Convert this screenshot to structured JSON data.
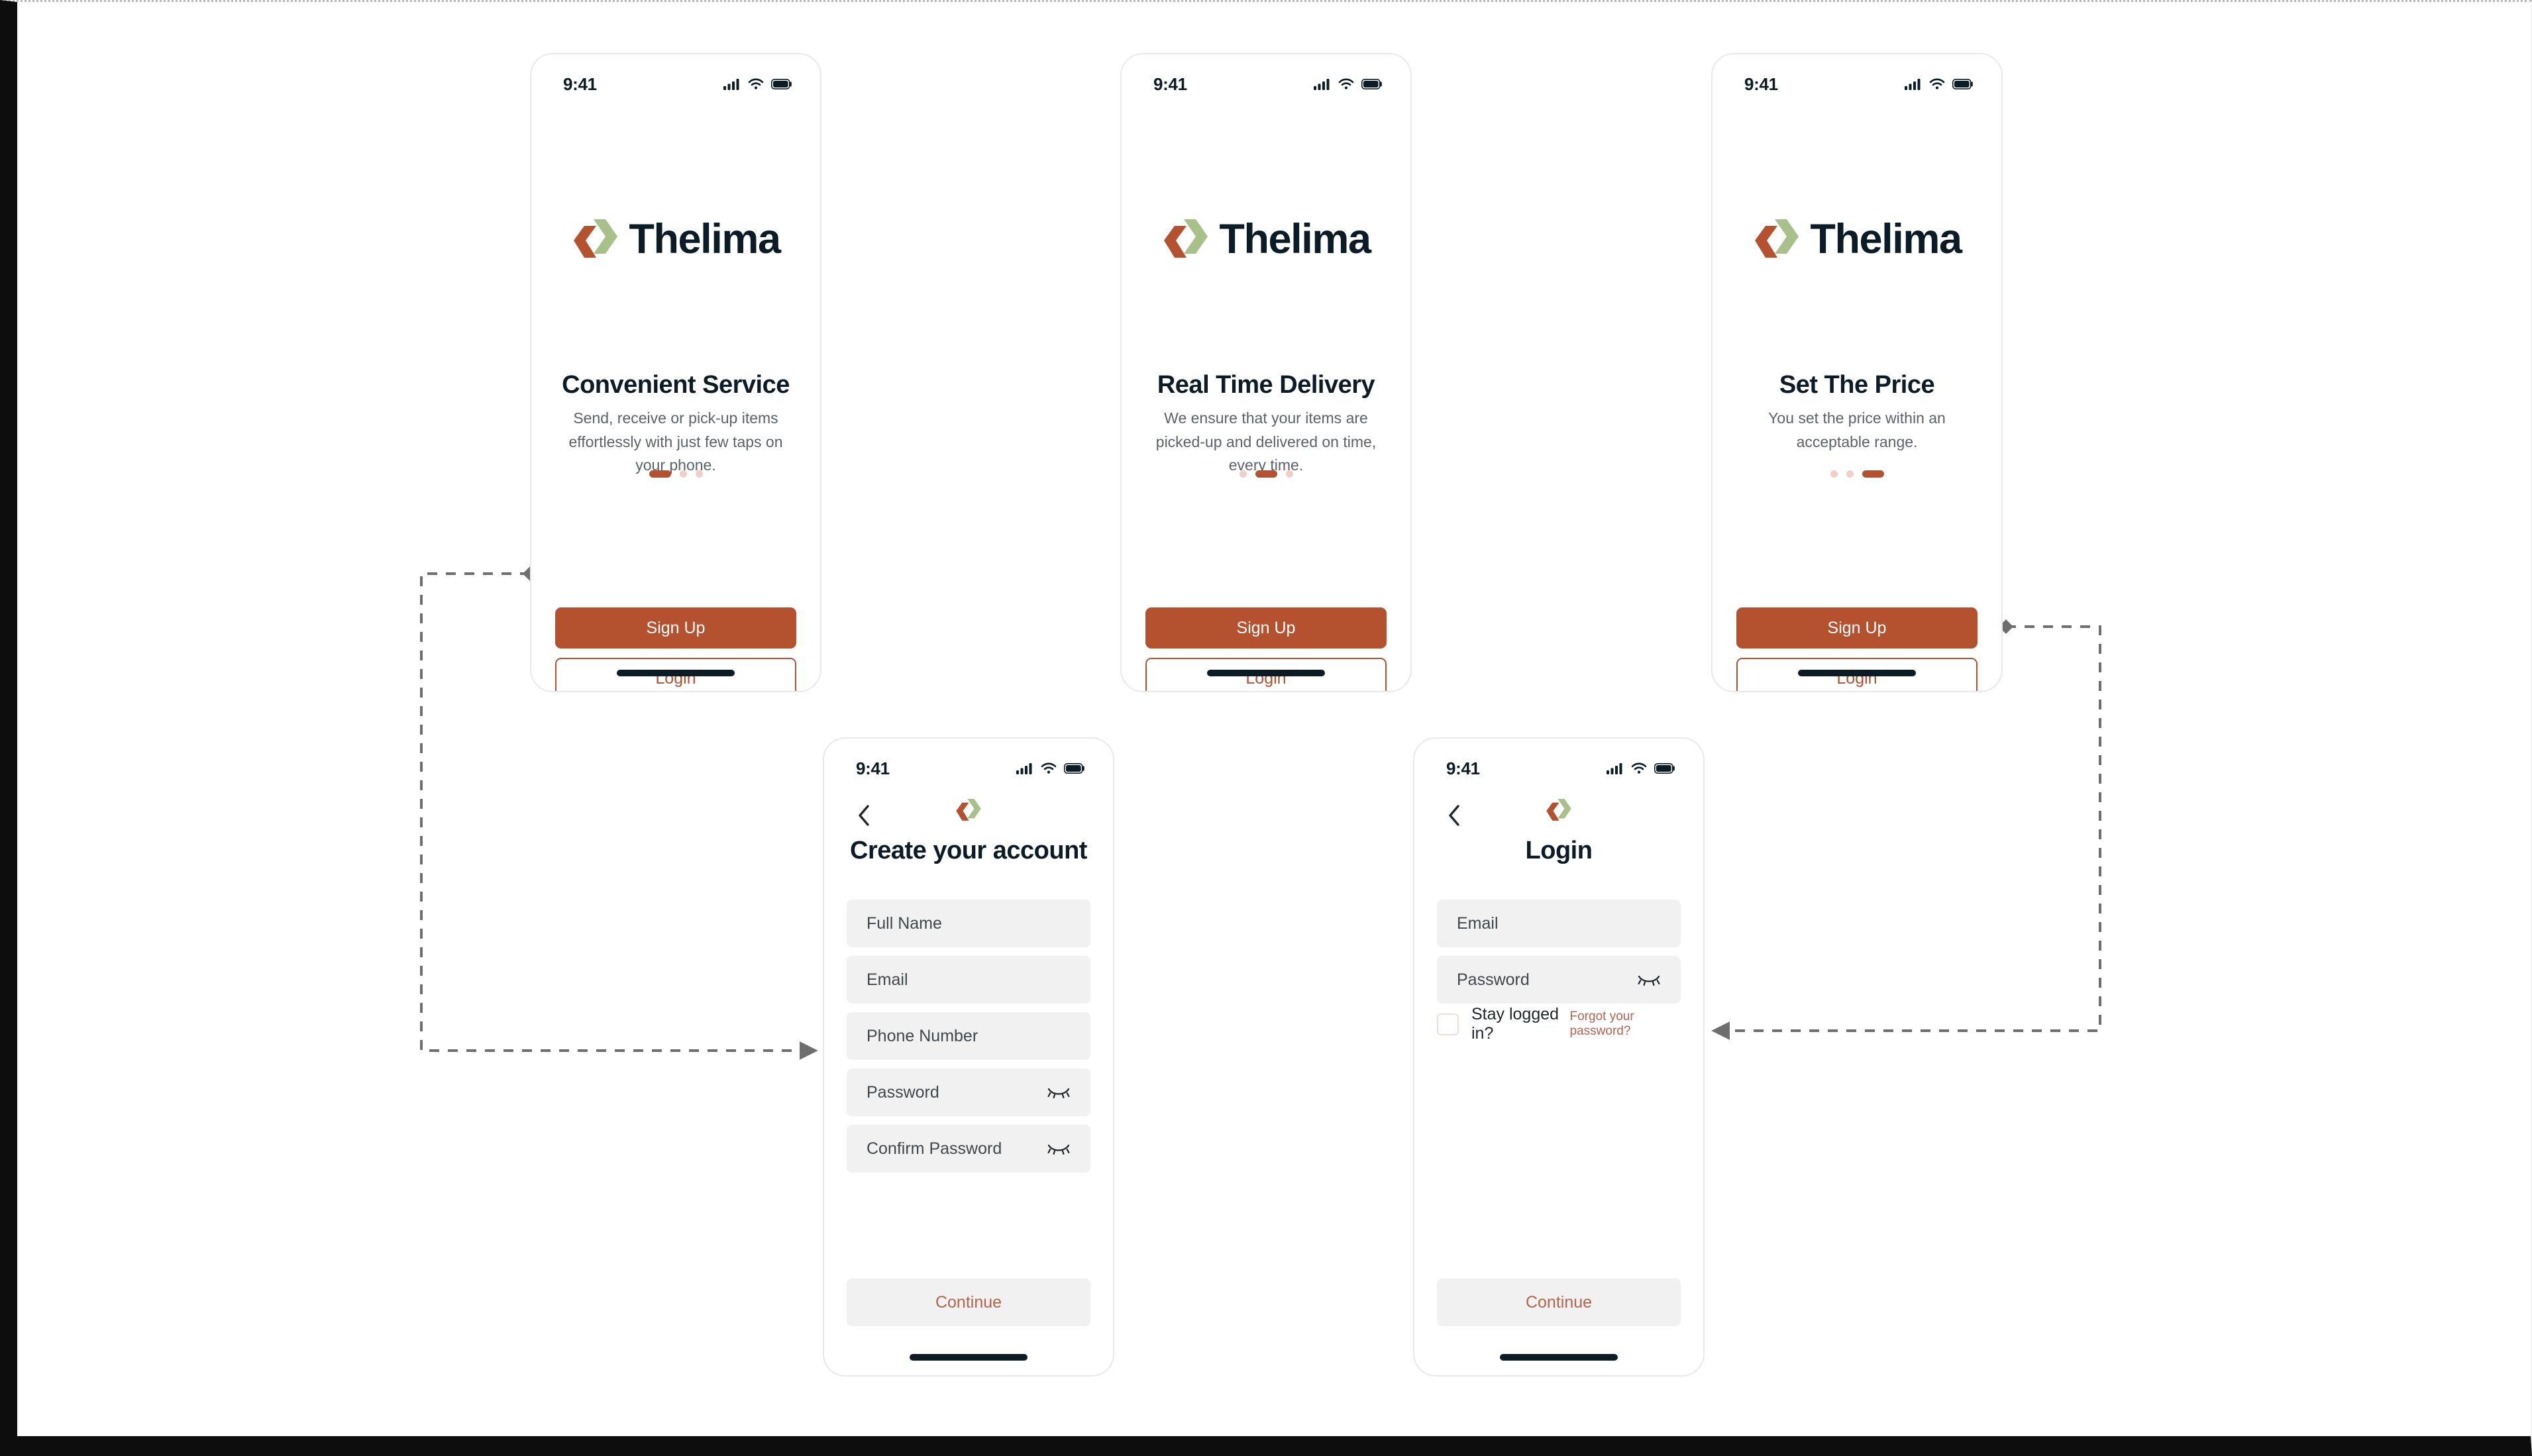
{
  "artboard": {
    "background": "#ffffff",
    "frame_color": "#0d0d0d"
  },
  "brand": {
    "name": "Thelima",
    "primary_color": "#b4512f",
    "accent_green": "#a8c089",
    "dark": "#0b1c27",
    "muted_text": "#5d6266",
    "field_bg": "#f1f1f1",
    "link_color": "#b4644d"
  },
  "status_bar": {
    "time": "9:41",
    "icons": [
      "cellular-signal-icon",
      "wifi-icon",
      "battery-icon"
    ]
  },
  "onboarding": [
    {
      "id": "convenient-service",
      "title": "Convenient Service",
      "subtitle": "Send, receive or pick-up items effortlessly with just few taps on your phone.",
      "active_dot": 0,
      "dot_count": 3,
      "primary_button": "Sign Up",
      "secondary_button": "Login"
    },
    {
      "id": "real-time-delivery",
      "title": "Real Time Delivery",
      "subtitle": "We ensure that your items are picked-up and delivered on time, every time.",
      "active_dot": 1,
      "dot_count": 3,
      "primary_button": "Sign Up",
      "secondary_button": "Login"
    },
    {
      "id": "set-the-price",
      "title": "Set The Price",
      "subtitle": "You set the price within an acceptable range.",
      "active_dot": 2,
      "dot_count": 3,
      "primary_button": "Sign Up",
      "secondary_button": "Login"
    }
  ],
  "signup_screen": {
    "title": "Create your account",
    "back_icon": "chevron-left-icon",
    "fields": [
      {
        "label": "Full Name",
        "placeholder": "Full Name",
        "type": "text",
        "toggle_icon": null
      },
      {
        "label": "Email",
        "placeholder": "Email",
        "type": "email",
        "toggle_icon": null
      },
      {
        "label": "Phone Number",
        "placeholder": "Phone Number",
        "type": "tel",
        "toggle_icon": null
      },
      {
        "label": "Password",
        "placeholder": "Password",
        "type": "password",
        "toggle_icon": "eye-off-icon"
      },
      {
        "label": "Confirm Password",
        "placeholder": "Confirm Password",
        "type": "password",
        "toggle_icon": "eye-off-icon"
      }
    ],
    "submit_button": "Continue"
  },
  "login_screen": {
    "title": "Login",
    "back_icon": "chevron-left-icon",
    "fields": [
      {
        "label": "Email",
        "placeholder": "Email",
        "type": "email",
        "toggle_icon": null
      },
      {
        "label": "Password",
        "placeholder": "Password",
        "type": "password",
        "toggle_icon": "eye-off-icon"
      }
    ],
    "stay_logged_in_label": "Stay logged in?",
    "stay_logged_in_checked": false,
    "forgot_password_label": "Forgot your password?",
    "submit_button": "Continue"
  },
  "flow_connectors": [
    {
      "id": "signup-flow",
      "from": "onboarding-1-signup-button",
      "to": "signup-screen",
      "start_marker": "diamond",
      "end_marker": "arrow",
      "style": "dashed",
      "color": "#6e6e6e"
    },
    {
      "id": "login-flow",
      "from": "onboarding-3-login-button",
      "to": "login-screen",
      "start_marker": "diamond",
      "end_marker": "arrow",
      "style": "dashed",
      "color": "#6e6e6e"
    }
  ]
}
